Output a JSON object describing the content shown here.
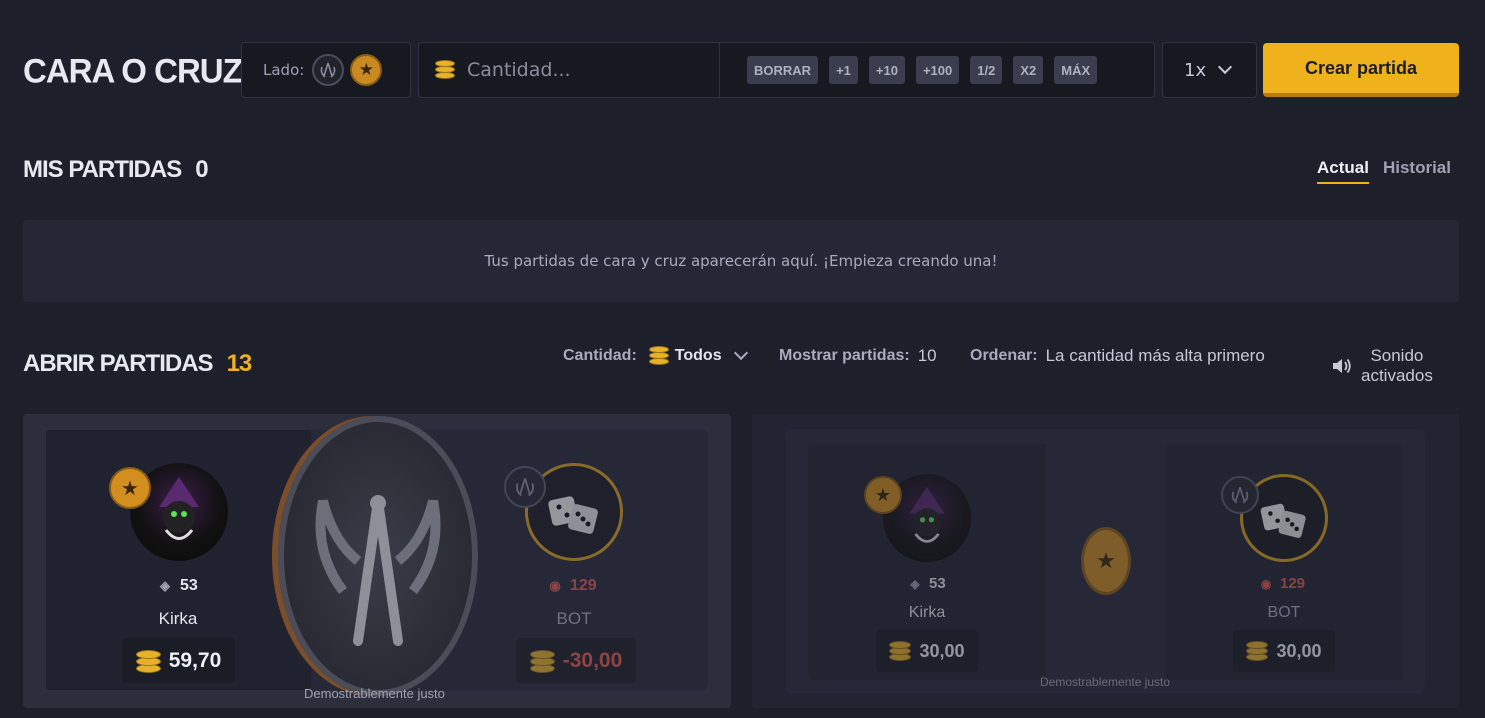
{
  "page": {
    "title": "CARA O CRUZ"
  },
  "create_bar": {
    "side_label": "Lado:",
    "amount_placeholder": "Cantidad...",
    "chips": [
      "BORRAR",
      "+1",
      "+10",
      "+100",
      "1/2",
      "X2",
      "MÁX"
    ],
    "multiplier": "1x",
    "create_button": "Crear partida"
  },
  "my_games": {
    "title": "MIS PARTIDAS",
    "count": "0",
    "tabs": {
      "actual": "Actual",
      "history": "Historial"
    },
    "empty_message": "Tus partidas de cara y cruz aparecerán aquí. ¡Empieza creando una!"
  },
  "open_games": {
    "title": "ABRIR PARTIDAS",
    "count": "13",
    "filters": {
      "amount_label": "Cantidad:",
      "amount_value": "Todos",
      "show_label": "Mostrar partidas:",
      "show_value": "10",
      "sort_label": "Ordenar:",
      "sort_value": "La cantidad más alta primero"
    },
    "sound": {
      "line1": "Sonido",
      "line2": "activados"
    },
    "games": [
      {
        "left": {
          "name": "Kirka",
          "level": "53",
          "amount": "59,70"
        },
        "right": {
          "name": "BOT",
          "level": "129",
          "amount": "-30,00"
        },
        "fair_label": "Demostrablemente justo"
      },
      {
        "left": {
          "name": "Kirka",
          "level": "53",
          "amount": "30,00"
        },
        "right": {
          "name": "BOT",
          "level": "129",
          "amount": "30,00"
        },
        "fair_label": "Demostrablemente justo"
      }
    ]
  },
  "colors": {
    "accent": "#f0b21c",
    "background": "#1d1f2b",
    "loss": "#c0443a"
  }
}
